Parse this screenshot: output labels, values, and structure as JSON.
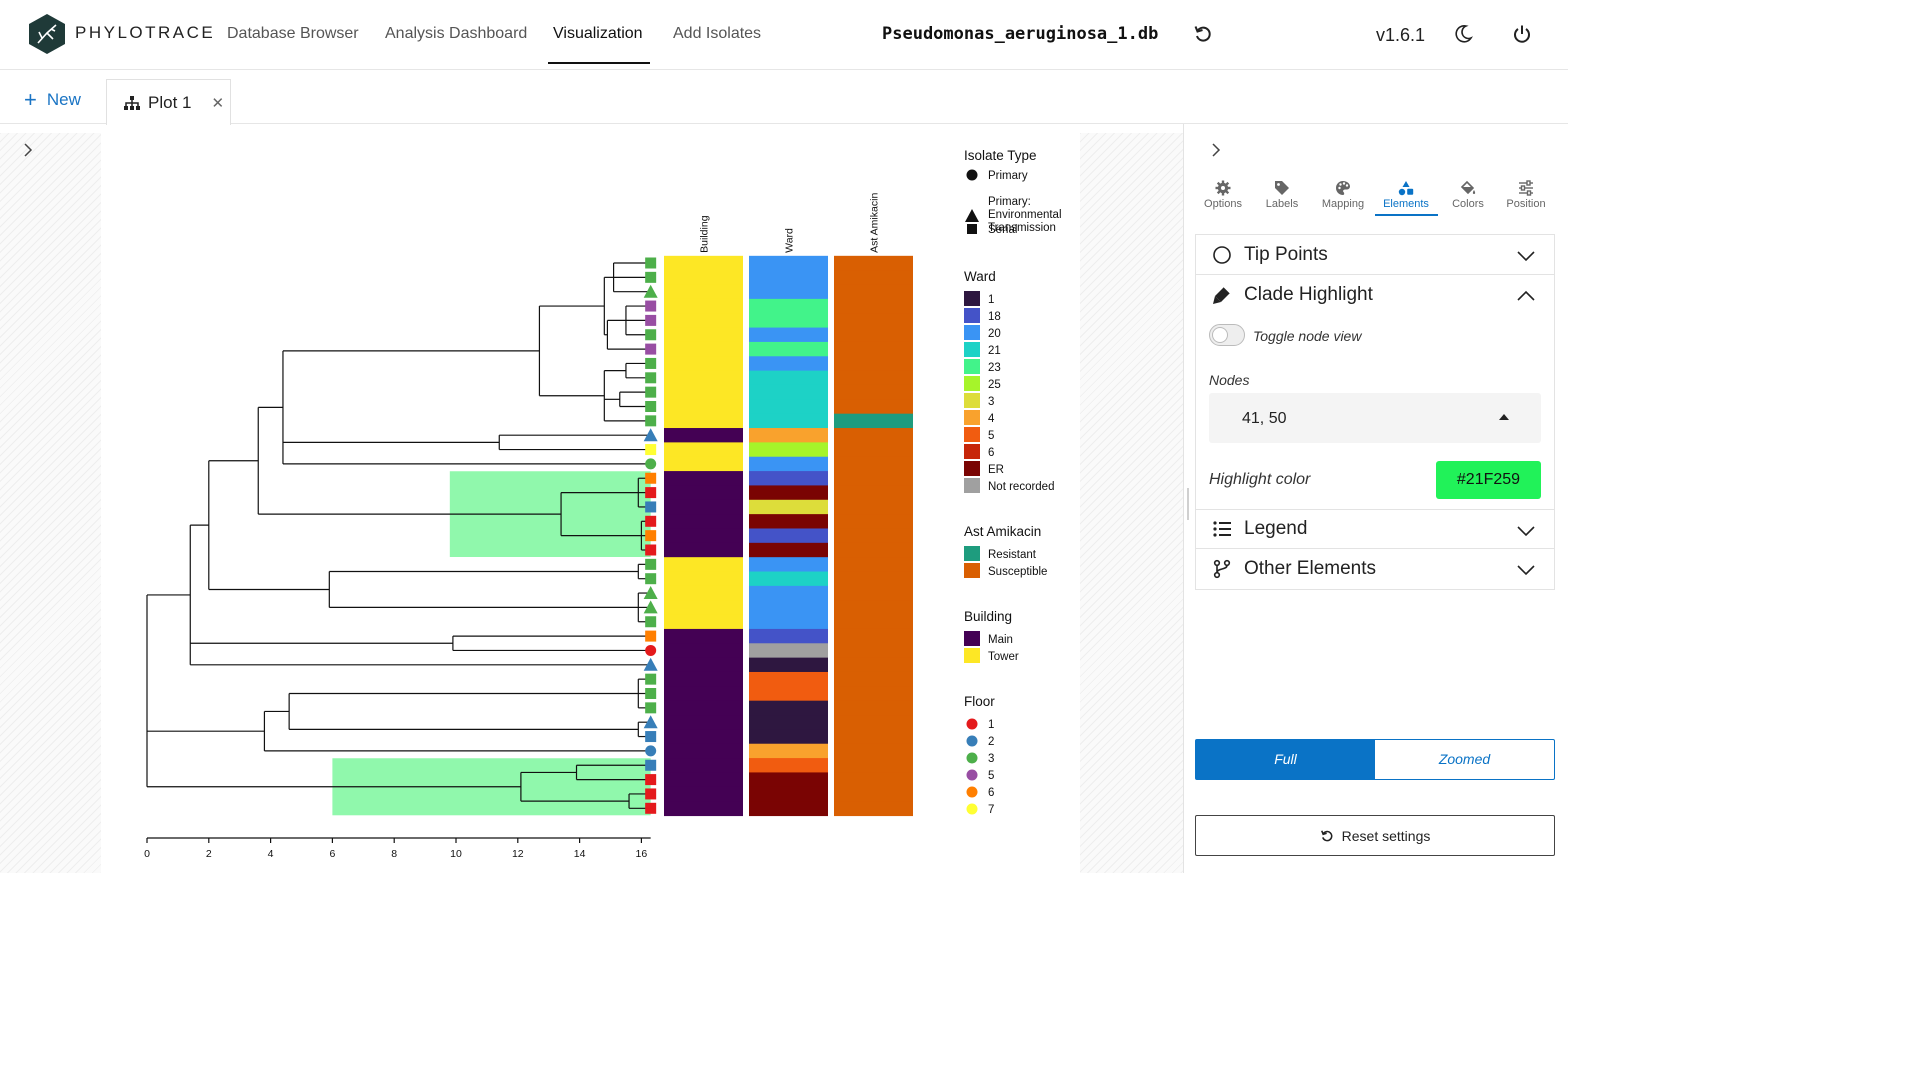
{
  "app": {
    "brand": "PHYLOTRACE",
    "db_name": "Pseudomonas_aeruginosa_1.db",
    "version": "v1.6.1"
  },
  "nav": [
    "Database Browser",
    "Analysis Dashboard",
    "Visualization",
    "Add Isolates"
  ],
  "nav_active": "Visualization",
  "tabs": {
    "new_label": "New",
    "plot_tab": "Plot 1"
  },
  "panel": {
    "tabs": [
      "Options",
      "Labels",
      "Mapping",
      "Elements",
      "Colors",
      "Position"
    ],
    "active_tab": "Elements",
    "sections": {
      "tip_points": "Tip Points",
      "clade_highlight": "Clade Highlight",
      "legend": "Legend",
      "other_elements": "Other Elements"
    },
    "toggle_node_view": "Toggle node view",
    "nodes_label": "Nodes",
    "nodes_value": "41, 50",
    "highlight_color_label": "Highlight color",
    "highlight_color": "#21F259",
    "view_full": "Full",
    "view_zoomed": "Zoomed",
    "reset": "Reset settings"
  },
  "chart_data": {
    "type": "phylogenetic-tree-heatmap",
    "x_axis": {
      "ticks": [
        0,
        2,
        4,
        6,
        8,
        10,
        12,
        14,
        16
      ],
      "range": [
        0,
        16.3
      ]
    },
    "tips": [
      {
        "shape": "square",
        "floor": "3",
        "building": "Tower",
        "ward": "20",
        "amikacin": "Susceptible"
      },
      {
        "shape": "square",
        "floor": "3",
        "building": "Tower",
        "ward": "20",
        "amikacin": "Susceptible"
      },
      {
        "shape": "triangle",
        "floor": "3",
        "building": "Tower",
        "ward": "20",
        "amikacin": "Susceptible"
      },
      {
        "shape": "square",
        "floor": "5",
        "building": "Tower",
        "ward": "23",
        "amikacin": "Susceptible"
      },
      {
        "shape": "square",
        "floor": "5",
        "building": "Tower",
        "ward": "23",
        "amikacin": "Susceptible"
      },
      {
        "shape": "square",
        "floor": "3",
        "building": "Tower",
        "ward": "20",
        "amikacin": "Susceptible"
      },
      {
        "shape": "square",
        "floor": "5",
        "building": "Tower",
        "ward": "23",
        "amikacin": "Susceptible"
      },
      {
        "shape": "square",
        "floor": "3",
        "building": "Tower",
        "ward": "20",
        "amikacin": "Susceptible"
      },
      {
        "shape": "square",
        "floor": "3",
        "building": "Tower",
        "ward": "21",
        "amikacin": "Susceptible"
      },
      {
        "shape": "square",
        "floor": "3",
        "building": "Tower",
        "ward": "21",
        "amikacin": "Susceptible"
      },
      {
        "shape": "square",
        "floor": "3",
        "building": "Tower",
        "ward": "21",
        "amikacin": "Susceptible"
      },
      {
        "shape": "square",
        "floor": "3",
        "building": "Tower",
        "ward": "21",
        "amikacin": "Resistant"
      },
      {
        "shape": "triangle",
        "floor": "2",
        "building": "Main",
        "ward": "4",
        "amikacin": "Susceptible"
      },
      {
        "shape": "square",
        "floor": "7",
        "building": "Tower",
        "ward": "25",
        "amikacin": "Susceptible"
      },
      {
        "shape": "circle",
        "floor": "3",
        "building": "Tower",
        "ward": "20",
        "amikacin": "Susceptible"
      },
      {
        "shape": "square",
        "floor": "6",
        "building": "Main",
        "ward": "18",
        "amikacin": "Susceptible"
      },
      {
        "shape": "square",
        "floor": "1",
        "building": "Main",
        "ward": "ER",
        "amikacin": "Susceptible"
      },
      {
        "shape": "square",
        "floor": "2",
        "building": "Main",
        "ward": "3",
        "amikacin": "Susceptible"
      },
      {
        "shape": "square",
        "floor": "1",
        "building": "Main",
        "ward": "ER",
        "amikacin": "Susceptible"
      },
      {
        "shape": "square",
        "floor": "6",
        "building": "Main",
        "ward": "18",
        "amikacin": "Susceptible"
      },
      {
        "shape": "square",
        "floor": "1",
        "building": "Main",
        "ward": "ER",
        "amikacin": "Susceptible"
      },
      {
        "shape": "square",
        "floor": "3",
        "building": "Tower",
        "ward": "20",
        "amikacin": "Susceptible"
      },
      {
        "shape": "square",
        "floor": "3",
        "building": "Tower",
        "ward": "21",
        "amikacin": "Susceptible"
      },
      {
        "shape": "triangle",
        "floor": "3",
        "building": "Tower",
        "ward": "20",
        "amikacin": "Susceptible"
      },
      {
        "shape": "triangle",
        "floor": "3",
        "building": "Tower",
        "ward": "20",
        "amikacin": "Susceptible"
      },
      {
        "shape": "square",
        "floor": "3",
        "building": "Tower",
        "ward": "20",
        "amikacin": "Susceptible"
      },
      {
        "shape": "square",
        "floor": "6",
        "building": "Main",
        "ward": "18",
        "amikacin": "Susceptible"
      },
      {
        "shape": "circle",
        "floor": "1",
        "building": "Main",
        "ward": "Not recorded",
        "amikacin": "Susceptible"
      },
      {
        "shape": "triangle",
        "floor": "2",
        "building": "Main",
        "ward": "1",
        "amikacin": "Susceptible"
      },
      {
        "shape": "square",
        "floor": "3",
        "building": "Main",
        "ward": "5",
        "amikacin": "Susceptible"
      },
      {
        "shape": "square",
        "floor": "3",
        "building": "Main",
        "ward": "5",
        "amikacin": "Susceptible"
      },
      {
        "shape": "square",
        "floor": "3",
        "building": "Main",
        "ward": "1",
        "amikacin": "Susceptible"
      },
      {
        "shape": "triangle",
        "floor": "2",
        "building": "Main",
        "ward": "1",
        "amikacin": "Susceptible"
      },
      {
        "shape": "square",
        "floor": "2",
        "building": "Main",
        "ward": "1",
        "amikacin": "Susceptible"
      },
      {
        "shape": "circle",
        "floor": "2",
        "building": "Main",
        "ward": "4",
        "amikacin": "Susceptible"
      },
      {
        "shape": "square",
        "floor": "2",
        "building": "Main",
        "ward": "5",
        "amikacin": "Susceptible"
      },
      {
        "shape": "square",
        "floor": "1",
        "building": "Main",
        "ward": "ER",
        "amikacin": "Susceptible"
      },
      {
        "shape": "square",
        "floor": "1",
        "building": "Main",
        "ward": "ER",
        "amikacin": "Susceptible"
      },
      {
        "shape": "square",
        "floor": "1",
        "building": "Main",
        "ward": "ER",
        "amikacin": "Susceptible"
      }
    ],
    "heatmap_columns": [
      "Building",
      "Ward",
      "Ast Amikacin"
    ],
    "highlighted_clades": {
      "nodes": [
        41,
        50
      ],
      "color": "#21F259"
    },
    "legends": {
      "isolate_type": {
        "title": "Isolate Type",
        "items": [
          {
            "label": "Primary",
            "shape": "circle"
          },
          {
            "label": "Primary:\nEnvironmental\nTransmission",
            "shape": "triangle"
          },
          {
            "label": "Serial",
            "shape": "square"
          }
        ]
      },
      "ward": {
        "title": "Ward",
        "items": [
          {
            "label": "1",
            "color": "#2E1740"
          },
          {
            "label": "18",
            "color": "#4453C8"
          },
          {
            "label": "20",
            "color": "#3A94F4"
          },
          {
            "label": "21",
            "color": "#1DD2C6"
          },
          {
            "label": "23",
            "color": "#42F38A"
          },
          {
            "label": "25",
            "color": "#A6F42A"
          },
          {
            "label": "3",
            "color": "#DDDD3A"
          },
          {
            "label": "4",
            "color": "#F9A22D"
          },
          {
            "label": "5",
            "color": "#F15C10"
          },
          {
            "label": "6",
            "color": "#C72609"
          },
          {
            "label": "ER",
            "color": "#7A0403"
          },
          {
            "label": "Not recorded",
            "color": "#A0A0A0"
          }
        ]
      },
      "amikacin": {
        "title": "Ast Amikacin",
        "items": [
          {
            "label": "Resistant",
            "color": "#1E9C7E"
          },
          {
            "label": "Susceptible",
            "color": "#D95F02"
          }
        ]
      },
      "building": {
        "title": "Building",
        "items": [
          {
            "label": "Main",
            "color": "#440154"
          },
          {
            "label": "Tower",
            "color": "#FDE725"
          }
        ]
      },
      "floor": {
        "title": "Floor",
        "items": [
          {
            "label": "1",
            "color": "#E41A1C"
          },
          {
            "label": "2",
            "color": "#377EB8"
          },
          {
            "label": "3",
            "color": "#4DAF4A"
          },
          {
            "label": "5",
            "color": "#984EA3"
          },
          {
            "label": "6",
            "color": "#FF7F00"
          },
          {
            "label": "7",
            "color": "#FFFF33"
          }
        ]
      }
    }
  }
}
